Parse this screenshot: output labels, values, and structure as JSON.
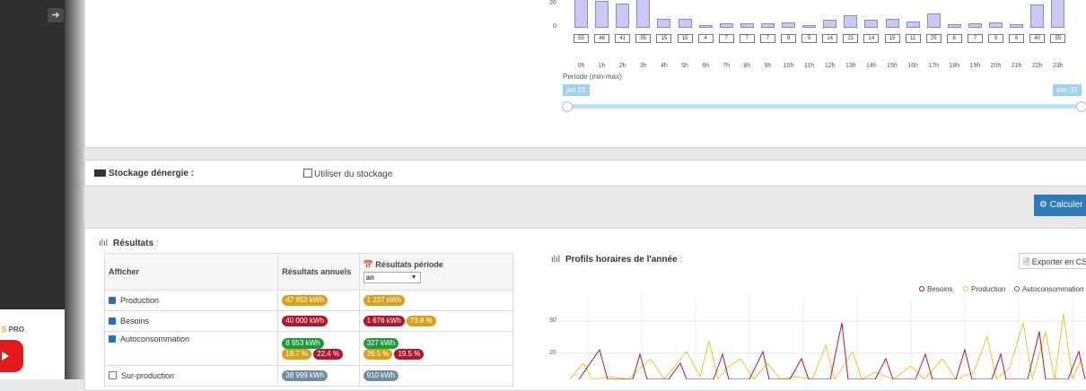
{
  "sidebar": {
    "promo_prefix": "S",
    "promo_suffix": "PRO"
  },
  "top_chart": {
    "y_ticks": [
      "20",
      "0"
    ],
    "values": [
      55,
      46,
      41,
      55,
      15,
      15,
      4,
      7,
      7,
      7,
      9,
      5,
      14,
      21,
      14,
      15,
      11,
      25,
      6,
      7,
      9,
      6,
      40,
      55
    ],
    "hours": [
      "0h",
      "1h",
      "2h",
      "3h",
      "4h",
      "5h",
      "6h",
      "7h",
      "8h",
      "9h",
      "10h",
      "11h",
      "12h",
      "13h",
      "14h",
      "15h",
      "16h",
      "17h",
      "18h",
      "19h",
      "20h",
      "21h",
      "22h",
      "23h"
    ],
    "periode_label": "Periode (min-max)",
    "range_start": "jan 01",
    "range_end": "dec 31"
  },
  "storage": {
    "title": "Stockage dénergie :",
    "checkbox_label": "Utiliser du stockage"
  },
  "calc_button": "Calculer",
  "results": {
    "title": "Résultats",
    "title_suffix": " :",
    "headers": {
      "afficher": "Afficher",
      "annual": "Résultats annuels",
      "period": "Résultats période"
    },
    "period_select": "an",
    "rows": [
      {
        "label": "Production",
        "checked": true,
        "annual": "47 952 kWh",
        "period": "1 237 kWh"
      },
      {
        "label": "Besoins",
        "checked": true,
        "annual": "40 000 kWh",
        "period": "1 676 kWh",
        "period_pct": "73.8 %"
      },
      {
        "label": "Autoconsommation",
        "checked": true,
        "annual": "8 953 kWh",
        "annual_pcts": [
          "18.7 %",
          "22.4 %"
        ],
        "period": "327 kWh",
        "period_pcts": [
          "26.5 %",
          "19.5 %"
        ]
      },
      {
        "label": "Sur-production",
        "checked": false,
        "annual": "38 999 kWh",
        "period": "910 kWh"
      }
    ]
  },
  "profiles": {
    "title": "Profils horaires de l'année",
    "title_suffix": " :",
    "export_label": "Exporter en CS",
    "legend": [
      {
        "name": "Besoins",
        "color": "#b0172f"
      },
      {
        "name": "Production",
        "color": "#e8c630"
      },
      {
        "name": "Autoconsommation",
        "color": "#1f9a3e"
      }
    ],
    "y_ticks": [
      "30",
      "20"
    ]
  },
  "colors": {
    "accent": "#2f7ab8",
    "bar_fill": "#c9c9f3",
    "besoins": "#b0172f",
    "production": "#e8c630"
  }
}
